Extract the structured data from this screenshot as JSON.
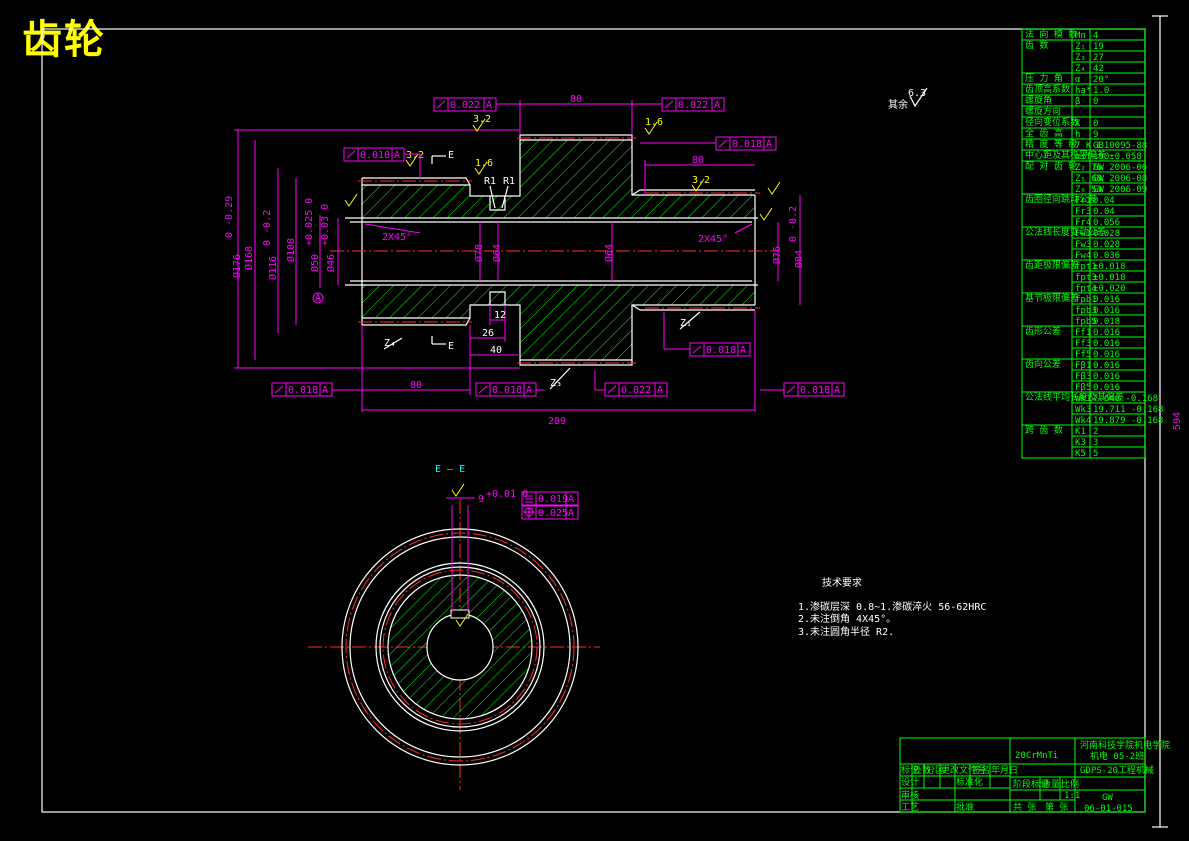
{
  "title": "齿轮",
  "sheet_dimension": "594",
  "dimensions": {
    "len_80_top": "80",
    "len_80_right": "80",
    "len_80_bottom": "80",
    "len_289": "289",
    "len_26": "26",
    "len_40": "40",
    "len_12": "12",
    "dia_176": "Ø176",
    "dia_176_tol": "0 -0.29",
    "dia_168": "Ø168",
    "dia_116": "Ø116",
    "dia_116_tol": "0 -0.2",
    "dia_108": "Ø108",
    "dia_50": "Ø50",
    "dia_50_tol": "+0.025 0",
    "dia_46": "Ø46",
    "dia_46_tol": "+0.03 0",
    "dia_78": "Ø78",
    "dia_64a": "Ø64",
    "dia_64b": "Ø64",
    "dia_76": "Ø76",
    "dia_84": "Ø84",
    "dia_84_tol": "0 -0.2",
    "chamfer_left": "2X45°",
    "chamfer_right": "2X45°",
    "radius_1a": "R1",
    "radius_1b": "R1",
    "key_width": "9",
    "key_width_tol": "+0.01 0"
  },
  "tolerances": {
    "t1": {
      "value": "0.022",
      "datum": "A"
    },
    "t2": {
      "value": "0.022",
      "datum": "A"
    },
    "t3": {
      "value": "0.018",
      "datum": "A"
    },
    "t4": {
      "value": "0.018",
      "datum": "A"
    },
    "t5": {
      "value": "0.018",
      "datum": "A"
    },
    "t6": {
      "value": "0.018",
      "datum": "A"
    },
    "t7": {
      "value": "0.018",
      "datum": "A"
    },
    "t8": {
      "value": "0.022",
      "datum": "A"
    },
    "t9": {
      "value": "0.018",
      "datum": "A"
    },
    "sym": {
      "value": "0.019",
      "datum": "A"
    },
    "pos": {
      "value": "0.025",
      "datum": "A"
    }
  },
  "labels": {
    "section_e": "E",
    "section_e2": "E",
    "section_title": "E — E",
    "datum_a": "A",
    "z4": "Z₄",
    "z3": "Z₃",
    "z1": "Z₁",
    "rest_label": "其余",
    "rest_rough": "6.3",
    "rough_32": "3.2",
    "rough_16": "1.6"
  },
  "tech_requirements": {
    "heading": "技术要求",
    "items": [
      "1.渗碳层深 0.8~1.渗碳淬火 56-62HRC",
      "2.未注倒角 4X45°。",
      "3.未注圆角半径 R2."
    ]
  },
  "param_table": {
    "rows": [
      [
        "法 向 模 数",
        "Mn",
        "4"
      ],
      [
        "齿 数",
        "Z₁",
        "19"
      ],
      [
        "",
        "Z₃",
        "27"
      ],
      [
        "",
        "Z₄",
        "42"
      ],
      [
        "压 力 角",
        "α",
        "20°"
      ],
      [
        "齿顶高系数",
        "ha*",
        "1.0"
      ],
      [
        "螺旋角",
        "β",
        "0"
      ],
      [
        "螺旋方向",
        "",
        ""
      ],
      [
        "径向变位系数",
        "X",
        "0"
      ],
      [
        "全 齿 高",
        "h",
        "9"
      ],
      [
        "精 度 等 级",
        "7 K L",
        "GB10095-88"
      ],
      [
        "中心距及其极限偏差",
        "α±f",
        "190±0.058"
      ],
      [
        "配 对 齿 轮",
        "Z₂ 76",
        "GW 2006-06"
      ],
      [
        "",
        "Z₅ 68",
        "GW 2006-08"
      ],
      [
        "",
        "Z₆ 53",
        "GW 2006-09"
      ],
      [
        "齿圈径向跳动公差",
        "Fr1",
        "0.04"
      ],
      [
        "",
        "Fr3",
        "0.04"
      ],
      [
        "",
        "Fr4",
        "0.056"
      ],
      [
        "公法线长度变动公差",
        "Fw1",
        "0.028"
      ],
      [
        "",
        "Fw3",
        "0.028"
      ],
      [
        "",
        "Fw4",
        "0.036"
      ],
      [
        "齿距极限偏差",
        "fpt1",
        "±0.018"
      ],
      [
        "",
        "fpt3",
        "±0.018"
      ],
      [
        "",
        "fpt4",
        "±0.020"
      ],
      [
        "基节极限偏差",
        "fpb1",
        "0.016"
      ],
      [
        "",
        "fpb3",
        "0.016"
      ],
      [
        "",
        "fpb5",
        "0.018"
      ],
      [
        "齿形公差",
        "Ff1",
        "0.016"
      ],
      [
        "",
        "Ff3",
        "0.016"
      ],
      [
        "",
        "Ff5",
        "0.016"
      ],
      [
        "齿向公差",
        "Fβ1",
        "0.016"
      ],
      [
        "",
        "Fβ3",
        "0.016"
      ],
      [
        "",
        "Fβ5",
        "0.016"
      ],
      [
        "公法线平均长度及其偏差",
        "Wk1",
        "7.646 -0.168"
      ],
      [
        "",
        "Wk3",
        "19.711 -0.168"
      ],
      [
        "",
        "Wk4",
        "19.879 -0.168"
      ],
      [
        "跨 齿 数",
        "K1",
        "2"
      ],
      [
        "",
        "K3",
        "3"
      ],
      [
        "",
        "K5",
        "5"
      ]
    ]
  },
  "title_block": {
    "material": "20CrMnTi",
    "company": "河南科技学院机电学院",
    "class": "机电 05-2班",
    "drawing_name": "GDPS-20工程机械",
    "scale": "1:1",
    "code1": "GW",
    "code2": "06-01-015",
    "cells": [
      "标记",
      "处数",
      "分区",
      "更改文件号",
      "签名",
      "年月日",
      "设计",
      "标准化",
      "审核",
      "工艺",
      "批准",
      "阶段标记",
      "重量",
      "比例",
      "共 张",
      "第 张"
    ]
  }
}
